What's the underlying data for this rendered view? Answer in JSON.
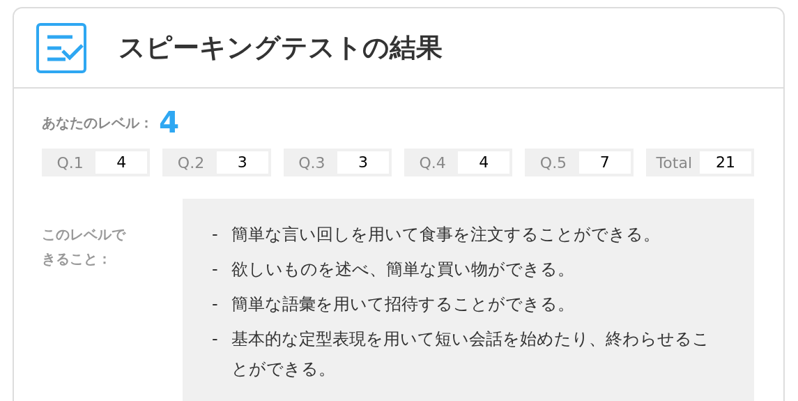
{
  "header": {
    "title": "スピーキングテストの結果"
  },
  "level": {
    "label": "あなたのレベル：",
    "value": "4"
  },
  "scores": [
    {
      "label": "Q.1",
      "value": "4"
    },
    {
      "label": "Q.2",
      "value": "3"
    },
    {
      "label": "Q.3",
      "value": "3"
    },
    {
      "label": "Q.4",
      "value": "4"
    },
    {
      "label": "Q.5",
      "value": "7"
    },
    {
      "label": "Total",
      "value": "21"
    }
  ],
  "can_do": {
    "label": "このレベルできること：",
    "items": [
      {
        "bullet": "-",
        "text": "簡単な言い回しを用いて食事を注文することができる。"
      },
      {
        "bullet": "-",
        "text": "欲しいものを述べ、簡単な買い物ができる。"
      },
      {
        "bullet": "-",
        "text": "簡単な語彙を用いて招待することができる。"
      },
      {
        "bullet": "-",
        "text": "基本的な定型表現を用いて短い会話を始めたり、終わらせることができる。"
      }
    ]
  }
}
